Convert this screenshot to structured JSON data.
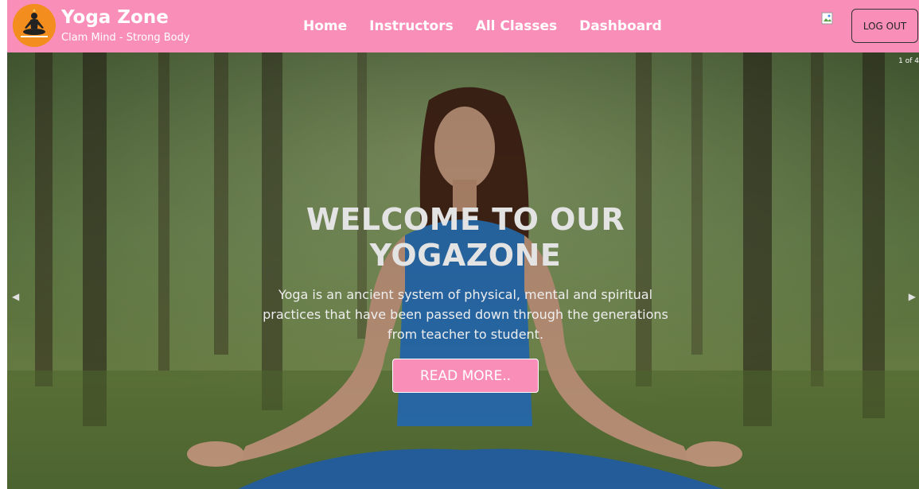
{
  "header": {
    "brand_title": "Yoga Zone",
    "brand_subtitle": "Clam Mind - Strong Body",
    "logo_icon": "meditation-logo-icon",
    "nav": [
      {
        "label": "Home"
      },
      {
        "label": "Instructors"
      },
      {
        "label": "All Classes"
      },
      {
        "label": "Dashboard"
      }
    ],
    "avatar_icon": "broken-image-avatar-icon",
    "logout_label": "LOG OUT"
  },
  "hero": {
    "slide_counter": "1 of 4",
    "title": "WELCOME TO OUR YOGAZONE",
    "text": "Yoga is an ancient system of physical, mental and spiritual practices that have been passed down through the generations from teacher to student.",
    "button_label": "READ MORE..",
    "prev_icon": "chevron-left-icon",
    "next_icon": "chevron-right-icon",
    "image_description": "woman meditating in forest"
  },
  "colors": {
    "accent_pink": "#f98fb8",
    "logo_orange": "#f28d1e"
  }
}
